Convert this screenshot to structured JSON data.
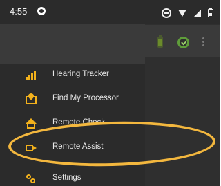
{
  "status_bar": {
    "time": "4:55",
    "icons": [
      "app-badge-icon",
      "dnd-icon",
      "wifi-icon",
      "signal-icon",
      "battery-icon"
    ]
  },
  "drawer": {
    "items": [
      {
        "label": "Hearing Tracker",
        "icon": "signal-bars-icon",
        "icon_color": "#f2b11c"
      },
      {
        "label": "Find My Processor",
        "icon": "map-pin-icon",
        "icon_color": "#f2b11c"
      },
      {
        "label": "Remote Check",
        "icon": "home-icon",
        "icon_color": "#f2b11c"
      },
      {
        "label": "Remote Assist",
        "icon": "video-icon",
        "icon_color": "#f2b11c"
      },
      {
        "label": "Settings",
        "icon": "settings-icon",
        "icon_color": "#f2b11c"
      }
    ]
  },
  "background_app": {
    "icons": [
      "battery-icon",
      "check-circle-icon",
      "more-vert-icon"
    ]
  },
  "highlight": {
    "target": "Remote Assist",
    "color": "#f3b73e"
  }
}
